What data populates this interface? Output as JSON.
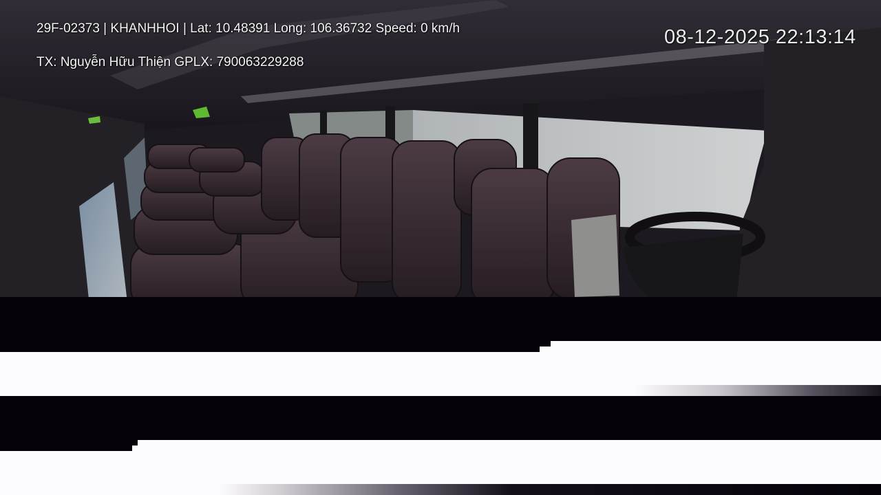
{
  "osd": {
    "vehicle_info": "29F-02373 | KHANHHOI | Lat: 10.48391 Long: 106.36732 Speed: 0 km/h",
    "driver_info": "TX: Nguyễn Hữu Thiện GPLX: 790063229288",
    "datetime": "08-12-2025 22:13:14"
  },
  "colors": {
    "osd_text": "#f4f4f4",
    "scene_dark": "#2a2630",
    "seat": "#4a3a45",
    "glitch_black": "#05020a",
    "glitch_white": "#fcfbfd"
  },
  "scene": {
    "description_icons": [
      "bus-interior-image",
      "seat-rows",
      "steering-wheel-icon"
    ]
  }
}
